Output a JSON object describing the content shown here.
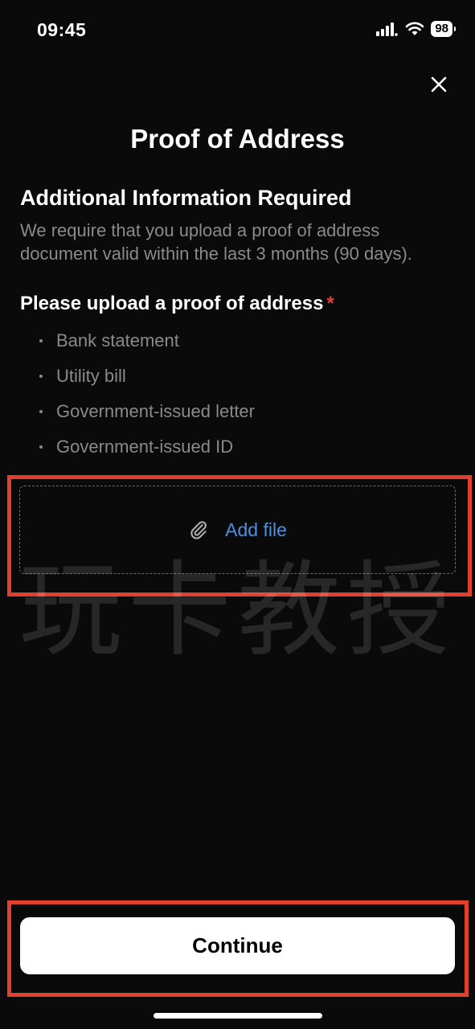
{
  "status_bar": {
    "time": "09:45",
    "battery": "98",
    "icons": [
      "signal-icon",
      "wifi-icon",
      "battery-icon"
    ]
  },
  "header": {
    "title": "Proof of Address",
    "close_icon": "close-icon"
  },
  "info": {
    "heading": "Additional Information Required",
    "body": "We require that you upload a proof of address document valid within the last 3 months (90 days)."
  },
  "upload": {
    "label": "Please upload a proof of address",
    "required_marker": "*",
    "documents": [
      "Bank statement",
      "Utility bill",
      "Government-issued letter",
      "Government-issued ID"
    ],
    "add_file_label": "Add file",
    "add_file_icon": "paperclip-icon"
  },
  "watermark": "玩卡教授",
  "footer": {
    "continue_label": "Continue"
  },
  "colors": {
    "background": "#0a0a0a",
    "accent": "#4a90e2",
    "required": "#e0413a",
    "annotation": "#e2402f",
    "muted_text": "#8a8a8a"
  }
}
